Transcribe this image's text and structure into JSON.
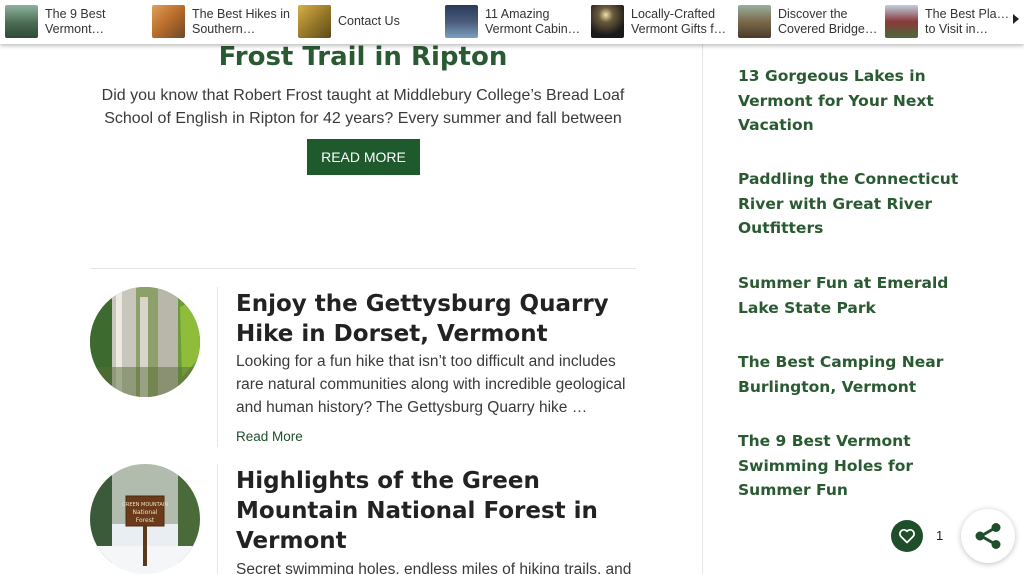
{
  "topbar": {
    "items": [
      {
        "line1": "The 9 Best",
        "line2": "Vermont…",
        "thumb_color": "#4a6b52"
      },
      {
        "line1": "The Best Hikes in",
        "line2": "Southern…",
        "thumb_color": "#b86b2a"
      },
      {
        "line1": "Contact Us",
        "line2": "",
        "thumb_color": "#9a7a2a"
      },
      {
        "line1": "11 Amazing",
        "line2": "Vermont Cabin…",
        "thumb_color": "#4a5a7a"
      },
      {
        "line1": "Locally-Crafted",
        "line2": "Vermont Gifts f…",
        "thumb_color": "#2a2a2a"
      },
      {
        "line1": "Discover the",
        "line2": "Covered Bridge…",
        "thumb_color": "#7a6a4a"
      },
      {
        "line1": "The Best Places",
        "line2": "to Visit in…",
        "thumb_color": "#8a3a3a"
      }
    ]
  },
  "top_post": {
    "title": "Frost Trail in Ripton",
    "excerpt": "Did you know that Robert Frost taught at Middlebury College’s Bread Loaf School of English in Ripton for 42 years? Every summer and fall between …",
    "button_label": "READ MORE"
  },
  "posts": [
    {
      "title": "Enjoy the Gettysburg Quarry Hike in Dorset, Vermont",
      "excerpt": "Looking for a fun hike that isn’t too difficult and includes rare natural communities along with incredible geological and human history? The Gettysburg Quarry hike …",
      "read_more": "Read More"
    },
    {
      "title": "Highlights of the Green Mountain National Forest in Vermont",
      "excerpt": "Secret swimming holes, endless miles of hiking trails, and"
    }
  ],
  "sign_text": [
    "GREEN MOUNTAIN",
    "National",
    "Forest"
  ],
  "sidebar": {
    "links": [
      "13 Gorgeous Lakes in Vermont for Your Next Vacation",
      "Paddling the Connecticut River with Great River Outfitters",
      "Summer Fun at Emerald Lake State Park",
      "The Best Camping Near Burlington, Vermont",
      "The 9 Best Vermont Swimming Holes for Summer Fun"
    ]
  },
  "share": {
    "like_count": "1"
  },
  "colors": {
    "brand_green": "#1f5a2d",
    "heading_green": "#2a5a32"
  }
}
